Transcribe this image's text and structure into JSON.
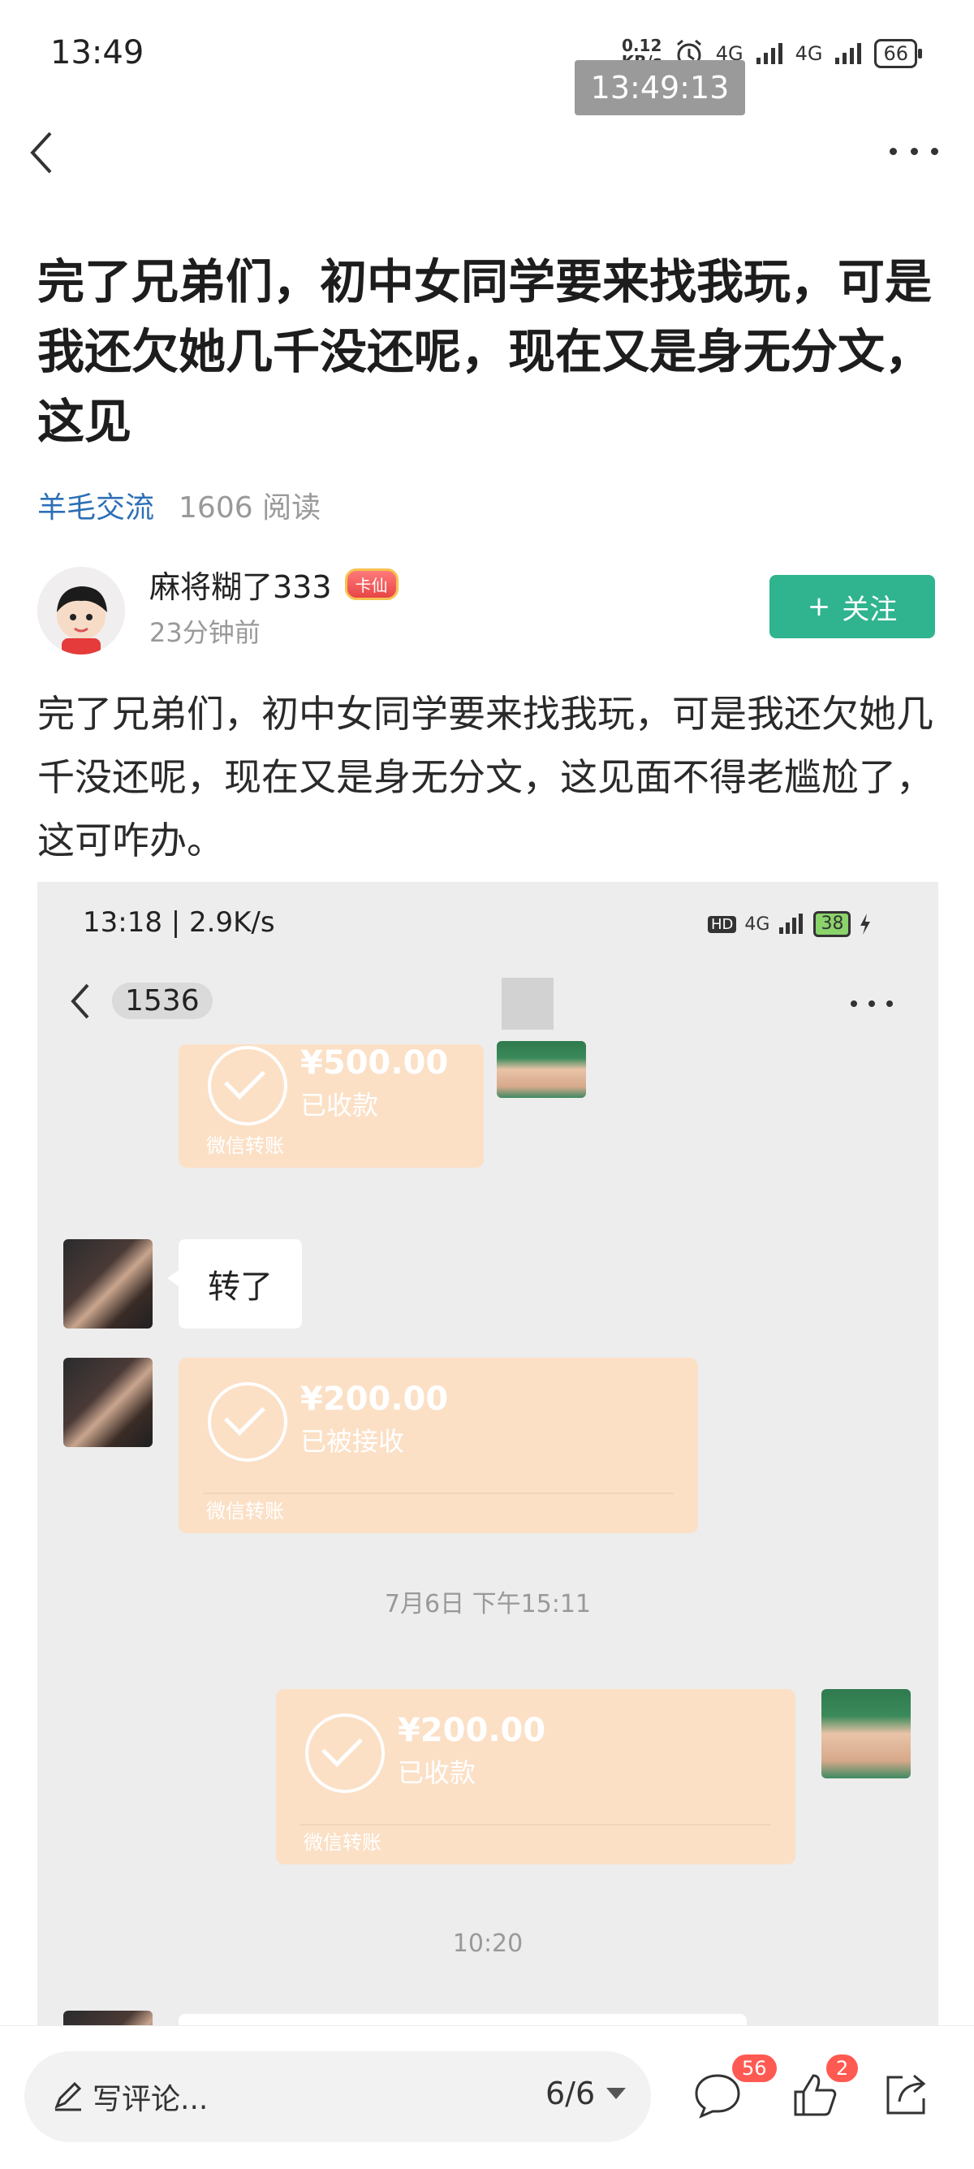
{
  "status_bar": {
    "time": "13:49",
    "net_speed_value": "0.12",
    "net_speed_unit": "KB/s",
    "network1": "4G",
    "network2": "4G",
    "battery": "66",
    "overlay_time": "13:49:13"
  },
  "post": {
    "title": "完了兄弟们，初中女同学要来找我玩，可是我还欠她几千没还呢，现在又是身无分文，这见",
    "topic": "羊毛交流",
    "reads": "1606 阅读",
    "author": "麻将糊了333",
    "badge": "卡仙",
    "posted": "23分钟前",
    "follow": "关注",
    "body": "完了兄弟们，初中女同学要来找我玩，可是我还欠她几千没还呢，现在又是身无分文，这见面不得老尴尬了，这可咋办。"
  },
  "screenshot": {
    "time": "13:18 | 2.9K/s",
    "hd": "HD",
    "network": "4G",
    "battery": "38",
    "count": "1536",
    "payments": [
      {
        "amount": "¥500.00",
        "status": "已收款",
        "label": "微信转账"
      },
      {
        "amount": "¥200.00",
        "status": "已被接收",
        "label": "微信转账"
      },
      {
        "amount": "¥200.00",
        "status": "已收款",
        "label": "微信转账"
      }
    ],
    "message": "转了",
    "stamp1": "7月6日 下午15:11",
    "stamp2": "10:20"
  },
  "bottom_bar": {
    "comment_placeholder": "写评论...",
    "page": "6/6",
    "comments": "56",
    "likes": "2"
  },
  "colors": {
    "follow": "#2fb48f",
    "topic": "#2d6fb7",
    "payment": "#fbe0c6",
    "badge_count": "#ff5a52"
  }
}
